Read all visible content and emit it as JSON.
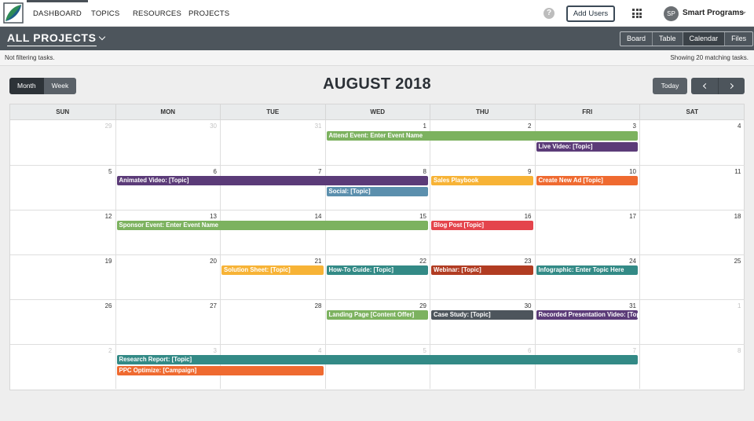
{
  "nav": {
    "items": [
      "DASHBOARD",
      "TOPICS",
      "RESOURCES",
      "PROJECTS"
    ],
    "help_label": "?",
    "add_users_label": "Add Users",
    "user_initials": "SP",
    "user_name": "Smart Programs"
  },
  "project_bar": {
    "title": "ALL PROJECTS",
    "views": [
      "Board",
      "Table",
      "Calendar",
      "Files"
    ],
    "active_view": "Calendar"
  },
  "filter_bar": {
    "left": "Not filtering tasks.",
    "right": "Showing 20 matching tasks."
  },
  "calendar": {
    "mode_buttons": [
      "Month",
      "Week"
    ],
    "active_mode": "Month",
    "title": "AUGUST 2018",
    "today_label": "Today",
    "weekdays": [
      "SUN",
      "MON",
      "TUE",
      "WED",
      "THU",
      "FRI",
      "SAT"
    ],
    "weeks": [
      [
        {
          "d": "29",
          "m": true
        },
        {
          "d": "30",
          "m": true
        },
        {
          "d": "31",
          "m": true
        },
        {
          "d": "1"
        },
        {
          "d": "2"
        },
        {
          "d": "3"
        },
        {
          "d": "4"
        }
      ],
      [
        {
          "d": "5"
        },
        {
          "d": "6"
        },
        {
          "d": "7"
        },
        {
          "d": "8"
        },
        {
          "d": "9"
        },
        {
          "d": "10"
        },
        {
          "d": "11"
        }
      ],
      [
        {
          "d": "12"
        },
        {
          "d": "13"
        },
        {
          "d": "14"
        },
        {
          "d": "15"
        },
        {
          "d": "16"
        },
        {
          "d": "17"
        },
        {
          "d": "18"
        }
      ],
      [
        {
          "d": "19"
        },
        {
          "d": "20"
        },
        {
          "d": "21"
        },
        {
          "d": "22"
        },
        {
          "d": "23"
        },
        {
          "d": "24"
        },
        {
          "d": "25"
        }
      ],
      [
        {
          "d": "26"
        },
        {
          "d": "27"
        },
        {
          "d": "28"
        },
        {
          "d": "29"
        },
        {
          "d": "30"
        },
        {
          "d": "31"
        },
        {
          "d": "1",
          "m": true
        }
      ],
      [
        {
          "d": "2",
          "m": true
        },
        {
          "d": "3",
          "m": true
        },
        {
          "d": "4",
          "m": true
        },
        {
          "d": "5",
          "m": true
        },
        {
          "d": "6",
          "m": true
        },
        {
          "d": "7",
          "m": true
        },
        {
          "d": "8",
          "m": true
        }
      ]
    ],
    "events": [
      {
        "title": "Attend Event: Enter Event Name",
        "week": 0,
        "start": 3,
        "span": 3,
        "lane": 0,
        "color": "#7cb25f"
      },
      {
        "title": "Live Video: [Topic]",
        "week": 0,
        "start": 5,
        "span": 1,
        "lane": 1,
        "color": "#5b3b78"
      },
      {
        "title": "Animated Video: [Topic]",
        "week": 1,
        "start": 1,
        "span": 3,
        "lane": 0,
        "color": "#5b3b78"
      },
      {
        "title": "Sales Playbook",
        "week": 1,
        "start": 4,
        "span": 1,
        "lane": 0,
        "color": "#f7b336"
      },
      {
        "title": "Create New Ad [Topic]",
        "week": 1,
        "start": 5,
        "span": 1,
        "lane": 0,
        "color": "#ef6a30"
      },
      {
        "title": "Social: [Topic]",
        "week": 1,
        "start": 3,
        "span": 1,
        "lane": 1,
        "color": "#5b8fad"
      },
      {
        "title": "Sponsor Event: Enter Event Name",
        "week": 2,
        "start": 1,
        "span": 3,
        "lane": 0,
        "color": "#7cb25f"
      },
      {
        "title": "Blog Post [Topic]",
        "week": 2,
        "start": 4,
        "span": 1,
        "lane": 0,
        "color": "#e4444c"
      },
      {
        "title": "Solution Sheet: [Topic]",
        "week": 3,
        "start": 2,
        "span": 1,
        "lane": 0,
        "color": "#f7b336"
      },
      {
        "title": "How-To Guide: [Topic]",
        "week": 3,
        "start": 3,
        "span": 1,
        "lane": 0,
        "color": "#338a86"
      },
      {
        "title": "Webinar: [Topic]",
        "week": 3,
        "start": 4,
        "span": 1,
        "lane": 0,
        "color": "#b13c22"
      },
      {
        "title": "Infographic: Enter Topic Here",
        "week": 3,
        "start": 5,
        "span": 1,
        "lane": 0,
        "color": "#338a86"
      },
      {
        "title": "Landing Page [Content Offer]",
        "week": 4,
        "start": 3,
        "span": 1,
        "lane": 0,
        "color": "#7cb25f"
      },
      {
        "title": "Case Study: [Topic]",
        "week": 4,
        "start": 4,
        "span": 1,
        "lane": 0,
        "color": "#4d555c"
      },
      {
        "title": "Recorded Presentation Video: [Topic]",
        "week": 4,
        "start": 5,
        "span": 1,
        "lane": 0,
        "color": "#5b3b78"
      },
      {
        "title": "Research Report: [Topic]",
        "week": 5,
        "start": 1,
        "span": 5,
        "lane": 0,
        "color": "#338a86"
      },
      {
        "title": "PPC Optimize: [Campaign]",
        "week": 5,
        "start": 1,
        "span": 2,
        "lane": 1,
        "color": "#ef6a30"
      }
    ]
  }
}
